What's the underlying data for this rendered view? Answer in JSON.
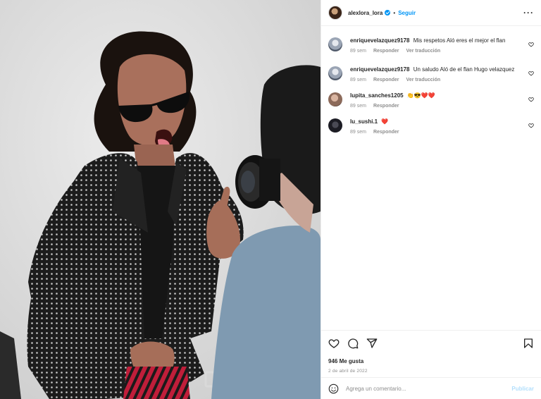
{
  "header": {
    "username": "alexlora_lora",
    "separator": "•",
    "follow_label": "Seguir",
    "more_icon": "more-dots-icon"
  },
  "comments": [
    {
      "user": "enriquevelazquez9178",
      "text": "Mis respetos Aló eres el mejor el flan",
      "time": "89 sem",
      "reply": "Responder",
      "translate": "Ver traducción",
      "avatar_color": "#9aa4b4"
    },
    {
      "user": "enriquevelazquez9178",
      "text": "Un saludo Aló de el flan Hugo velazquez",
      "time": "89 sem",
      "reply": "Responder",
      "translate": "Ver traducción",
      "avatar_color": "#9aa4b4"
    },
    {
      "user": "lupita_sanches1205",
      "text": "👏😎❤️❤️",
      "time": "89 sem",
      "reply": "Responder",
      "avatar_color": "#8c6a5a"
    },
    {
      "user": "lu_sushi.1",
      "text": "❤️",
      "time": "89 sem",
      "reply": "Responder",
      "avatar_color": "#1c1c24"
    }
  ],
  "stats": {
    "likes": "946 Me gusta",
    "date": "2 de abril de 2022"
  },
  "composer": {
    "placeholder": "Agrega un comentario...",
    "publish_label": "Publicar"
  },
  "icons": {
    "like": "heart-icon",
    "comment": "comment-icon",
    "share": "share-icon",
    "save": "bookmark-icon",
    "emoji": "emoji-icon"
  },
  "colors": {
    "accent": "#0095f6",
    "publish_disabled": "#b2dffc",
    "muted": "#8e8e8e",
    "heart": "#ed4956"
  }
}
